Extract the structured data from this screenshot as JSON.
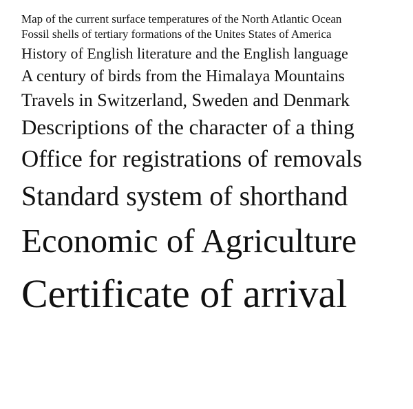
{
  "specimen_lines": [
    "Map of the current surface temperatures of the North Atlantic Ocean",
    "Fossil shells of tertiary formations of the Unites States of America",
    "History of English literature and the English language",
    "A century of birds from the Himalaya Mountains",
    "Travels in Switzerland, Sweden and Denmark",
    "Descriptions of the character of a thing",
    "Office for registrations of removals",
    "Standard system of shorthand",
    "Economic of Agriculture",
    "Certificate of arrival"
  ],
  "colors": {
    "background": "#ffffff",
    "text": "#111111"
  }
}
